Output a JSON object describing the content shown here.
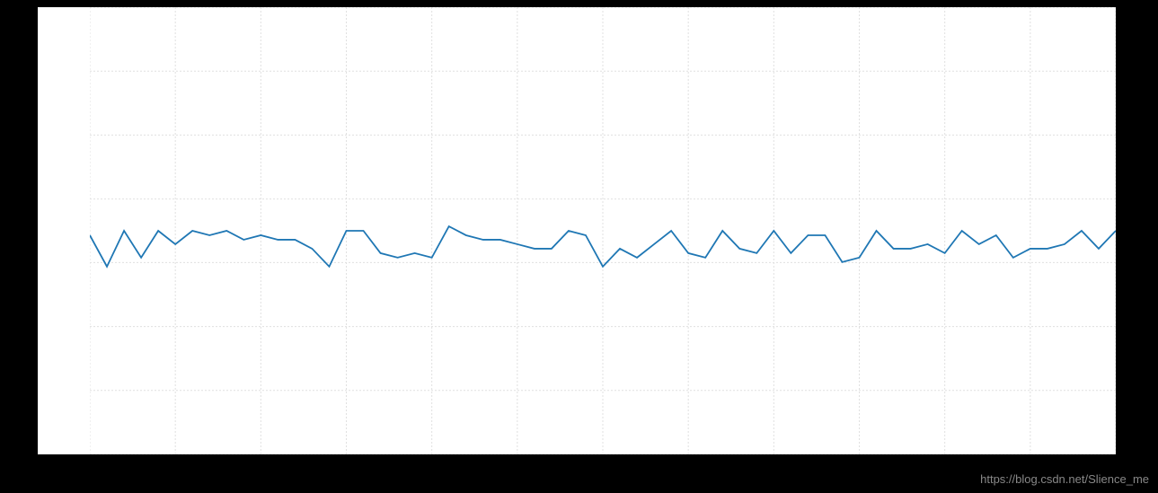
{
  "watermark": "https://blog.csdn.net/Slience_me",
  "chart_data": {
    "type": "line",
    "line_color": "#1f77b4",
    "bg_color": "#ffffff",
    "xlim": [
      0,
      60
    ],
    "ylim": [
      0,
      100
    ],
    "x_grid": [
      0,
      5,
      10,
      15,
      20,
      25,
      30,
      35,
      40,
      45,
      50,
      55,
      60
    ],
    "y_grid": [
      0,
      14.3,
      28.6,
      42.9,
      57.1,
      71.4,
      85.7,
      100
    ],
    "x": [
      0,
      1,
      2,
      3,
      4,
      5,
      6,
      7,
      8,
      9,
      10,
      11,
      12,
      13,
      14,
      15,
      16,
      17,
      18,
      19,
      20,
      21,
      22,
      23,
      24,
      25,
      26,
      27,
      28,
      29,
      30,
      31,
      32,
      33,
      34,
      35,
      36,
      37,
      38,
      39,
      40,
      41,
      42,
      43,
      44,
      45,
      46,
      47,
      48,
      49,
      50,
      51,
      52,
      53,
      54,
      55,
      56,
      57,
      58,
      59,
      60
    ],
    "values": [
      49,
      42,
      50,
      44,
      50,
      47,
      50,
      49,
      50,
      48,
      49,
      48,
      48,
      46,
      42,
      50,
      50,
      45,
      44,
      45,
      44,
      51,
      49,
      48,
      48,
      47,
      46,
      46,
      50,
      49,
      42,
      46,
      44,
      47,
      50,
      45,
      44,
      50,
      46,
      45,
      50,
      45,
      49,
      49,
      43,
      44,
      50,
      46,
      46,
      47,
      45,
      50,
      47,
      49,
      44,
      46,
      46,
      47,
      50,
      46,
      50
    ]
  }
}
